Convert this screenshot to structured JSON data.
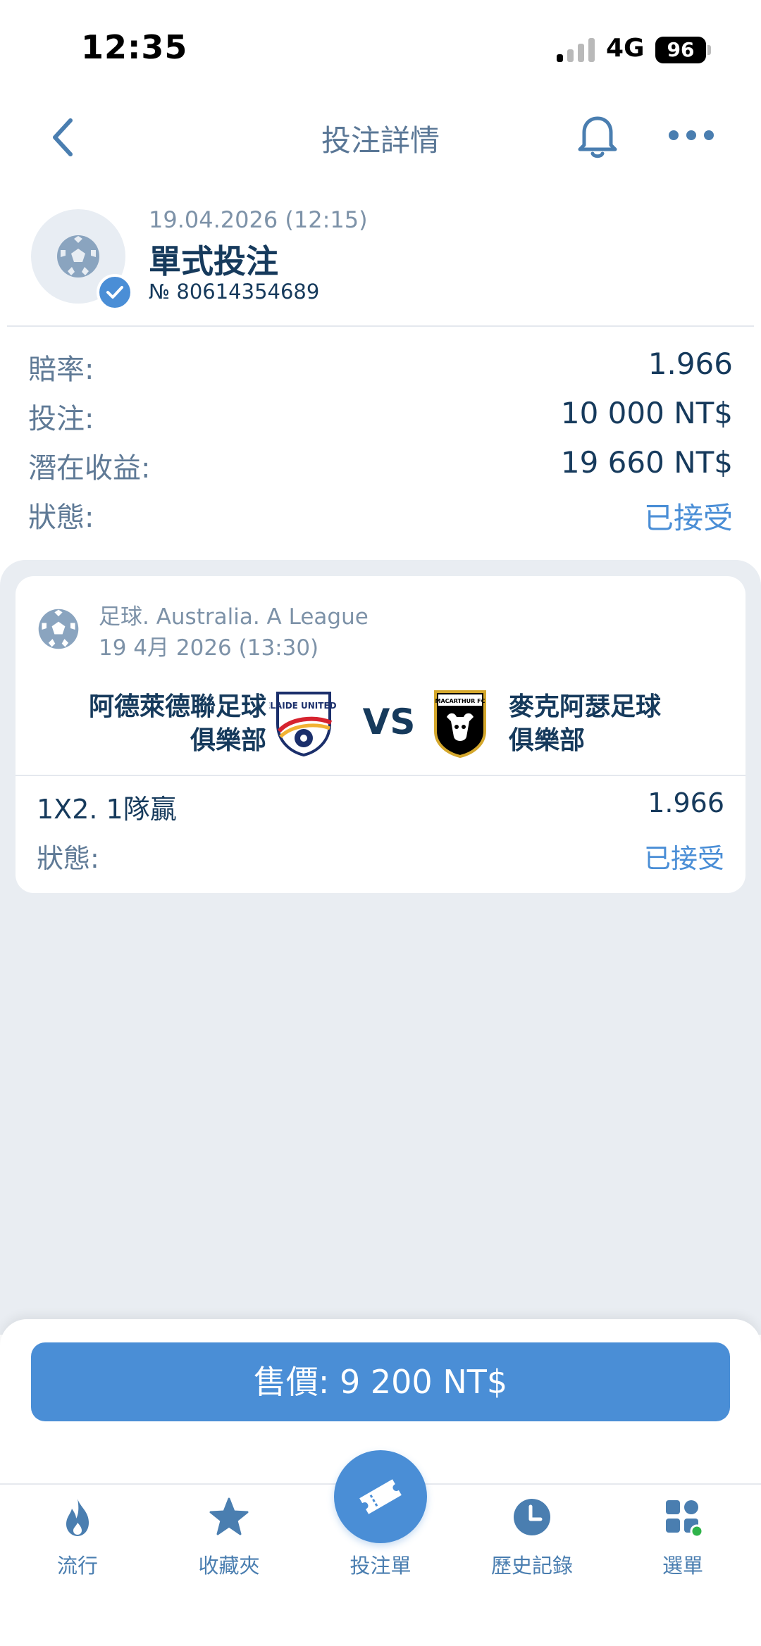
{
  "status_bar": {
    "time": "12:35",
    "network": "4G",
    "battery": "96"
  },
  "nav": {
    "title": "投注詳情"
  },
  "bet": {
    "date": "19.04.2026 (12:15)",
    "type": "單式投注",
    "number": "№ 80614354689"
  },
  "summary": {
    "odds_label": "賠率:",
    "odds_value": "1.966",
    "stake_label": "投注:",
    "stake_value": "10 000 NT$",
    "potential_label": "潛在收益:",
    "potential_value": "19 660 NT$",
    "status_label": "狀態:",
    "status_value": "已接受"
  },
  "event": {
    "league": "足球. Australia. A League",
    "time": "19 4月 2026 (13:30)",
    "home_line1": "阿德萊德聯足球",
    "home_line2": "俱樂部",
    "vs": "VS",
    "away_line1": "麥克阿瑟足球",
    "away_line2": "俱樂部",
    "home_logo_text": "ADELAIDE UNITED F.C.",
    "away_logo_text": "MACARTHUR FC",
    "market": "1X2. 1隊贏",
    "market_odds": "1.966",
    "status_label": "狀態:",
    "status_value": "已接受"
  },
  "sell_button": "售價: 9 200 NT$",
  "tabs": {
    "popular": "流行",
    "favorites": "收藏夾",
    "betslip": "投注單",
    "history": "歷史記錄",
    "menu": "選單"
  },
  "colors": {
    "accent": "#4a8ed6",
    "text": "#163a5c",
    "muted": "#5f7a96",
    "background_grey": "#e9edf2"
  }
}
